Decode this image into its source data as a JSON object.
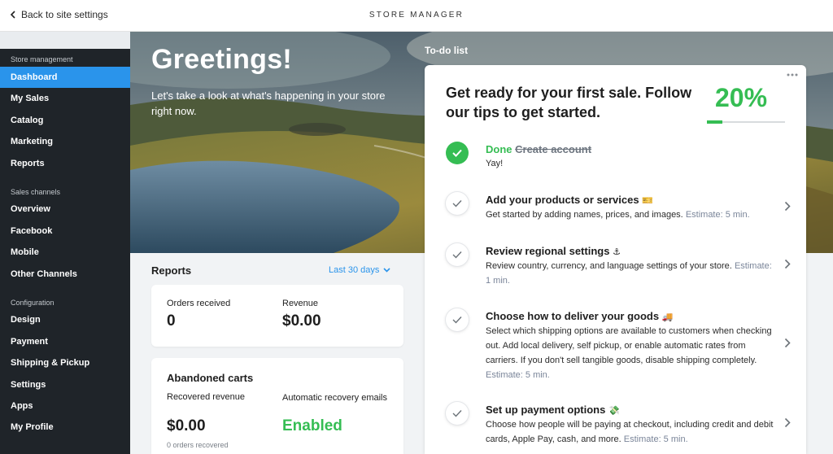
{
  "topbar": {
    "back_label": "Back to site settings",
    "title": "STORE MANAGER"
  },
  "sidebar": {
    "sections": [
      {
        "label": "Store management"
      },
      {
        "label": "Sales channels"
      },
      {
        "label": "Configuration"
      }
    ],
    "items": [
      {
        "label": "Dashboard",
        "active": true
      },
      {
        "label": "My Sales"
      },
      {
        "label": "Catalog"
      },
      {
        "label": "Marketing"
      },
      {
        "label": "Reports"
      },
      {
        "label": "Overview"
      },
      {
        "label": "Facebook"
      },
      {
        "label": "Mobile"
      },
      {
        "label": "Other Channels"
      },
      {
        "label": "Design"
      },
      {
        "label": "Payment"
      },
      {
        "label": "Shipping & Pickup"
      },
      {
        "label": "Settings"
      },
      {
        "label": "Apps"
      },
      {
        "label": "My Profile"
      }
    ]
  },
  "hero": {
    "greeting": "Greetings!",
    "subtitle": "Let's take a look at what's happening in your store right now."
  },
  "reports": {
    "title": "Reports",
    "period": "Last 30 days",
    "orders_label": "Orders received",
    "orders_value": "0",
    "revenue_label": "Revenue",
    "revenue_value": "$0.00",
    "abandoned": {
      "title": "Abandoned carts",
      "recovered_label": "Recovered revenue",
      "recovered_value": "$0.00",
      "recovered_note": "0 orders recovered",
      "auto_label": "Automatic recovery emails",
      "auto_value": "Enabled"
    }
  },
  "todo": {
    "heading": "To-do list",
    "headline": "Get ready for your first sale. Follow our tips to get started.",
    "progress_text": "20%",
    "progress_fraction": 0.2,
    "tasks": [
      {
        "status": "Done",
        "title": "Create account",
        "desc": "Yay!"
      },
      {
        "title": "Add your products or services",
        "emoji": "🎫",
        "desc": "Get started by adding names, prices, and images.",
        "estimate": "Estimate: 5 min."
      },
      {
        "title": "Review regional settings",
        "emoji": "⚓",
        "desc": "Review country, currency, and language settings of your store.",
        "estimate": "Estimate: 1 min."
      },
      {
        "title": "Choose how to deliver your goods",
        "emoji": "🚚",
        "desc": "Select which shipping options are available to customers when checking out. Add local delivery, self pickup, or enable automatic rates from carriers. If you don't sell tangible goods, disable shipping completely.",
        "estimate": "Estimate: 5 min."
      },
      {
        "title": "Set up payment options",
        "emoji": "💸",
        "desc": "Choose how people will be paying at checkout, including credit and debit cards, Apple Pay, cash, and more.",
        "estimate": "Estimate: 5 min."
      }
    ]
  },
  "colors": {
    "accent": "#2a94eb",
    "success": "#35bd53",
    "sidebar_bg": "#1f2429"
  }
}
